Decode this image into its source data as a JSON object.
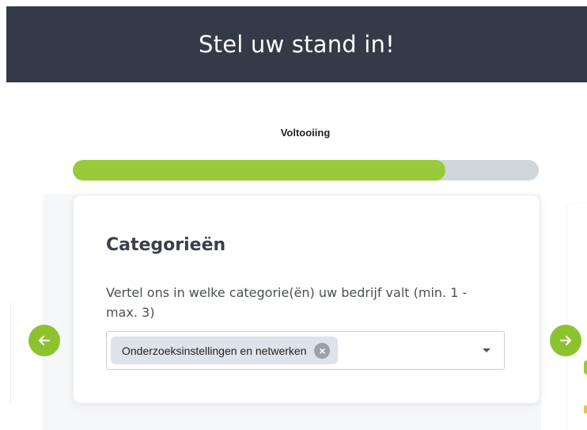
{
  "header": {
    "title": "Stel uw stand in!"
  },
  "progress": {
    "label": "Voltooiing",
    "value": 0.8,
    "fill_color": "#9ac93a",
    "track_color": "#cfd7dd"
  },
  "card": {
    "title": "Categorieën",
    "description": "Vertel ons in welke categorie(ën) uw bedrijf valt (min. 1 - max. 3)",
    "select": {
      "selected": [
        "Onderzoeksinstellingen en netwerken"
      ],
      "remove_icon": "close-circle-icon",
      "caret_icon": "chevron-down-icon"
    }
  },
  "nav": {
    "prev_icon": "arrow-left-icon",
    "next_icon": "arrow-right-icon",
    "accent_color": "#8dc22f"
  }
}
